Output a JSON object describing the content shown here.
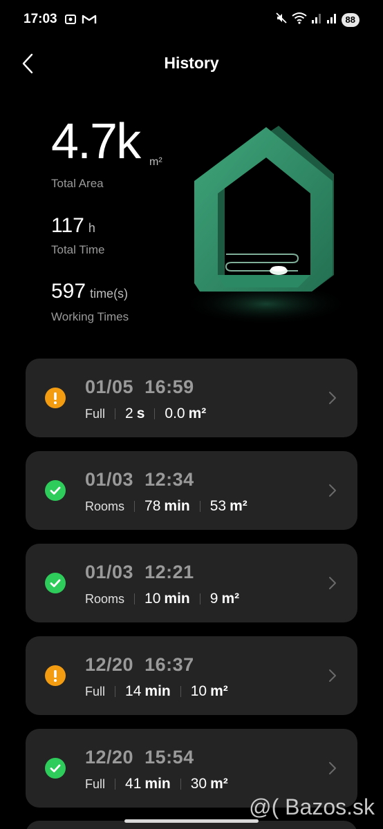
{
  "status_bar": {
    "time": "17:03",
    "battery": "88",
    "icons_left": [
      "screenshot-icon",
      "gmail-icon"
    ],
    "icons_right": [
      "mute-icon",
      "wifi-icon",
      "signal-icon",
      "signal-icon"
    ]
  },
  "header": {
    "title": "History",
    "back_icon": "chevron-left-icon"
  },
  "stats": {
    "total_area_value": "4.7k",
    "total_area_unit": "m²",
    "total_area_label": "Total Area",
    "total_time_value": "117",
    "total_time_unit": "h",
    "total_time_label": "Total Time",
    "working_times_value": "597",
    "working_times_unit": "time(s)",
    "working_times_label": "Working Times"
  },
  "records": [
    {
      "date": "01/05",
      "time": "16:59",
      "mode": "Full",
      "duration_value": "2",
      "duration_unit": "s",
      "area_value": "0.0",
      "area_unit": "m²",
      "status": "warning",
      "status_color": "#f39c12"
    },
    {
      "date": "01/03",
      "time": "12:34",
      "mode": "Rooms",
      "duration_value": "78",
      "duration_unit": "min",
      "area_value": "53",
      "area_unit": "m²",
      "status": "success",
      "status_color": "#2ecc5a"
    },
    {
      "date": "01/03",
      "time": "12:21",
      "mode": "Rooms",
      "duration_value": "10",
      "duration_unit": "min",
      "area_value": "9",
      "area_unit": "m²",
      "status": "success",
      "status_color": "#2ecc5a"
    },
    {
      "date": "12/20",
      "time": "16:37",
      "mode": "Full",
      "duration_value": "14",
      "duration_unit": "min",
      "area_value": "10",
      "area_unit": "m²",
      "status": "warning",
      "status_color": "#f39c12"
    },
    {
      "date": "12/20",
      "time": "15:54",
      "mode": "Full",
      "duration_value": "41",
      "duration_unit": "min",
      "area_value": "30",
      "area_unit": "m²",
      "status": "success",
      "status_color": "#2ecc5a"
    }
  ],
  "watermark": "@( Bazos.sk",
  "colors": {
    "background": "#000000",
    "card": "#242424",
    "accent_green": "#2ecc5a",
    "warning_orange": "#f39c12",
    "illustration_green": "#2f8a63"
  }
}
